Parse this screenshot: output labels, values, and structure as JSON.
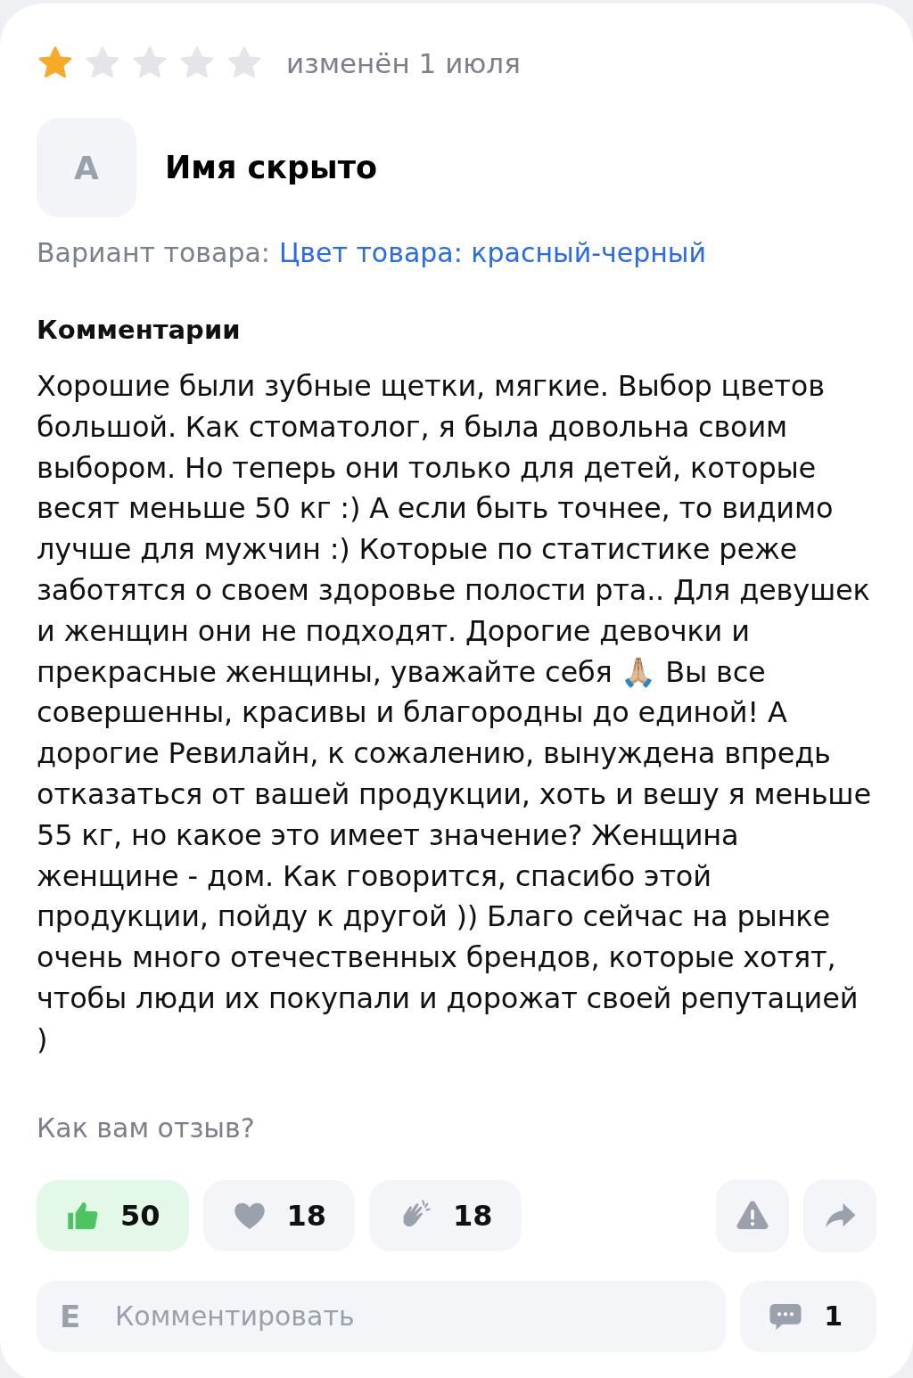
{
  "review": {
    "stars": 1,
    "date": "изменён 1 июля",
    "avatar_letter": "А",
    "author": "Имя скрыто",
    "variant_label": "Вариант товара:",
    "variant_value": "Цвет товара: красный-черный",
    "comments_heading": "Комментарии",
    "text": "Хорошие были зубные щетки, мягкие. Выбор цветов большой. Как стоматолог, я была довольна своим выбором. Но теперь они только для детей, которые весят меньше 50 кг :) А если быть точнее, то видимо лучше для мужчин :) Которые по статистике реже заботятся о своем здоровье полости рта.. Для девушек и женщин они не подходят. Дорогие девочки и прекрасные женщины, уважайте себя 🙏🏼 Вы все совершенны, красивы и благородны до единой! А дорогие Ревилайн, к сожалению, вынуждена впредь отказаться от вашей продукции, хоть и вешу я меньше 55 кг, но какое это имеет значение? Женщина женщине - дом. Как говорится, спасибо этой продукции, пойду к другой )) Благо сейчас на рынке очень много отечественных брендов, которые хотят, чтобы люди их покупали и дорожат своей репутацией )",
    "feedback_prompt": "Как вам отзыв?"
  },
  "reactions": [
    {
      "kind": "like",
      "count": "50",
      "selected": true
    },
    {
      "kind": "heart",
      "count": "18",
      "selected": false
    },
    {
      "kind": "clap",
      "count": "18",
      "selected": false
    }
  ],
  "comment": {
    "user_letter": "Е",
    "placeholder": "Комментировать",
    "count": "1"
  }
}
